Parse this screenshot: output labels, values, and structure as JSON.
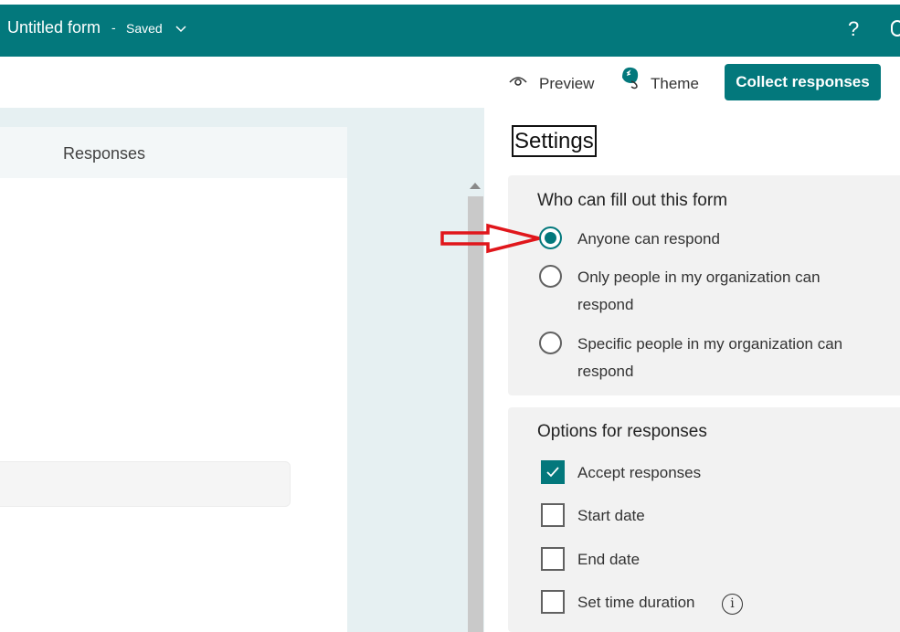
{
  "header": {
    "title": "Untitled form",
    "separator": "-",
    "status": "Saved",
    "help_label": "?"
  },
  "commandbar": {
    "preview_label": "Preview",
    "theme_label": "Theme",
    "collect_label": "Collect responses"
  },
  "form": {
    "tab_responses": "Responses"
  },
  "settings": {
    "title": "Settings",
    "who_heading": "Who can fill out this form",
    "who_options": [
      {
        "label_line1": "Anyone can respond",
        "label_line2": "",
        "selected": true
      },
      {
        "label_line1": "Only people in my organization can",
        "label_line2": "respond",
        "selected": false
      },
      {
        "label_line1": "Specific people in my organization can",
        "label_line2": "respond",
        "selected": false
      }
    ],
    "options_heading": "Options for responses",
    "options": [
      {
        "label": "Accept responses",
        "checked": true
      },
      {
        "label": "Start date",
        "checked": false
      },
      {
        "label": "End date",
        "checked": false
      },
      {
        "label": "Set time duration",
        "checked": false
      }
    ],
    "info_glyph": "i"
  },
  "colors": {
    "accent": "#03787c",
    "annotation_arrow": "#e0161b"
  }
}
